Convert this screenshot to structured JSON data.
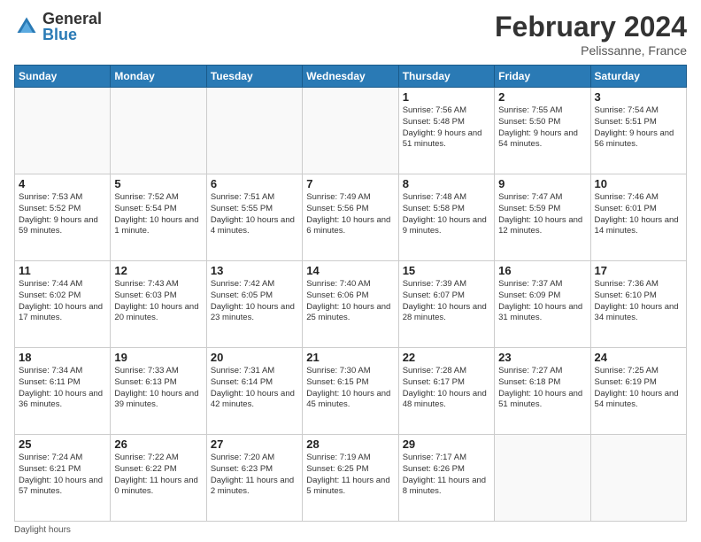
{
  "header": {
    "logo_general": "General",
    "logo_blue": "Blue",
    "title": "February 2024",
    "location": "Pelissanne, France"
  },
  "days_of_week": [
    "Sunday",
    "Monday",
    "Tuesday",
    "Wednesday",
    "Thursday",
    "Friday",
    "Saturday"
  ],
  "weeks": [
    [
      {
        "day": "",
        "info": ""
      },
      {
        "day": "",
        "info": ""
      },
      {
        "day": "",
        "info": ""
      },
      {
        "day": "",
        "info": ""
      },
      {
        "day": "1",
        "info": "Sunrise: 7:56 AM\nSunset: 5:48 PM\nDaylight: 9 hours and 51 minutes."
      },
      {
        "day": "2",
        "info": "Sunrise: 7:55 AM\nSunset: 5:50 PM\nDaylight: 9 hours and 54 minutes."
      },
      {
        "day": "3",
        "info": "Sunrise: 7:54 AM\nSunset: 5:51 PM\nDaylight: 9 hours and 56 minutes."
      }
    ],
    [
      {
        "day": "4",
        "info": "Sunrise: 7:53 AM\nSunset: 5:52 PM\nDaylight: 9 hours and 59 minutes."
      },
      {
        "day": "5",
        "info": "Sunrise: 7:52 AM\nSunset: 5:54 PM\nDaylight: 10 hours and 1 minute."
      },
      {
        "day": "6",
        "info": "Sunrise: 7:51 AM\nSunset: 5:55 PM\nDaylight: 10 hours and 4 minutes."
      },
      {
        "day": "7",
        "info": "Sunrise: 7:49 AM\nSunset: 5:56 PM\nDaylight: 10 hours and 6 minutes."
      },
      {
        "day": "8",
        "info": "Sunrise: 7:48 AM\nSunset: 5:58 PM\nDaylight: 10 hours and 9 minutes."
      },
      {
        "day": "9",
        "info": "Sunrise: 7:47 AM\nSunset: 5:59 PM\nDaylight: 10 hours and 12 minutes."
      },
      {
        "day": "10",
        "info": "Sunrise: 7:46 AM\nSunset: 6:01 PM\nDaylight: 10 hours and 14 minutes."
      }
    ],
    [
      {
        "day": "11",
        "info": "Sunrise: 7:44 AM\nSunset: 6:02 PM\nDaylight: 10 hours and 17 minutes."
      },
      {
        "day": "12",
        "info": "Sunrise: 7:43 AM\nSunset: 6:03 PM\nDaylight: 10 hours and 20 minutes."
      },
      {
        "day": "13",
        "info": "Sunrise: 7:42 AM\nSunset: 6:05 PM\nDaylight: 10 hours and 23 minutes."
      },
      {
        "day": "14",
        "info": "Sunrise: 7:40 AM\nSunset: 6:06 PM\nDaylight: 10 hours and 25 minutes."
      },
      {
        "day": "15",
        "info": "Sunrise: 7:39 AM\nSunset: 6:07 PM\nDaylight: 10 hours and 28 minutes."
      },
      {
        "day": "16",
        "info": "Sunrise: 7:37 AM\nSunset: 6:09 PM\nDaylight: 10 hours and 31 minutes."
      },
      {
        "day": "17",
        "info": "Sunrise: 7:36 AM\nSunset: 6:10 PM\nDaylight: 10 hours and 34 minutes."
      }
    ],
    [
      {
        "day": "18",
        "info": "Sunrise: 7:34 AM\nSunset: 6:11 PM\nDaylight: 10 hours and 36 minutes."
      },
      {
        "day": "19",
        "info": "Sunrise: 7:33 AM\nSunset: 6:13 PM\nDaylight: 10 hours and 39 minutes."
      },
      {
        "day": "20",
        "info": "Sunrise: 7:31 AM\nSunset: 6:14 PM\nDaylight: 10 hours and 42 minutes."
      },
      {
        "day": "21",
        "info": "Sunrise: 7:30 AM\nSunset: 6:15 PM\nDaylight: 10 hours and 45 minutes."
      },
      {
        "day": "22",
        "info": "Sunrise: 7:28 AM\nSunset: 6:17 PM\nDaylight: 10 hours and 48 minutes."
      },
      {
        "day": "23",
        "info": "Sunrise: 7:27 AM\nSunset: 6:18 PM\nDaylight: 10 hours and 51 minutes."
      },
      {
        "day": "24",
        "info": "Sunrise: 7:25 AM\nSunset: 6:19 PM\nDaylight: 10 hours and 54 minutes."
      }
    ],
    [
      {
        "day": "25",
        "info": "Sunrise: 7:24 AM\nSunset: 6:21 PM\nDaylight: 10 hours and 57 minutes."
      },
      {
        "day": "26",
        "info": "Sunrise: 7:22 AM\nSunset: 6:22 PM\nDaylight: 11 hours and 0 minutes."
      },
      {
        "day": "27",
        "info": "Sunrise: 7:20 AM\nSunset: 6:23 PM\nDaylight: 11 hours and 2 minutes."
      },
      {
        "day": "28",
        "info": "Sunrise: 7:19 AM\nSunset: 6:25 PM\nDaylight: 11 hours and 5 minutes."
      },
      {
        "day": "29",
        "info": "Sunrise: 7:17 AM\nSunset: 6:26 PM\nDaylight: 11 hours and 8 minutes."
      },
      {
        "day": "",
        "info": ""
      },
      {
        "day": "",
        "info": ""
      }
    ]
  ],
  "footer": {
    "note": "Daylight hours"
  }
}
